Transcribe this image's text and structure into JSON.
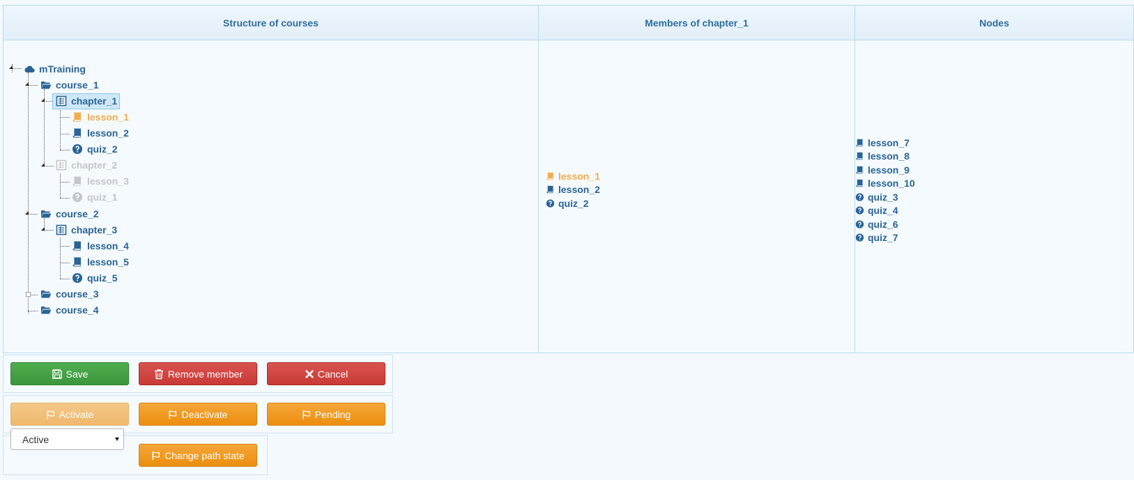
{
  "columns": {
    "structure": "Structure of courses",
    "members": "Members of chapter_1",
    "nodes": "Nodes"
  },
  "tree": {
    "root": "mTraining",
    "course_1": "course_1",
    "chapter_1": "chapter_1",
    "c1_lesson_1": "lesson_1",
    "c1_lesson_2": "lesson_2",
    "c1_quiz_2": "quiz_2",
    "chapter_2": "chapter_2",
    "c2_lesson_3": "lesson_3",
    "c2_quiz_1": "quiz_1",
    "course_2": "course_2",
    "chapter_3": "chapter_3",
    "c3_lesson_4": "lesson_4",
    "c3_lesson_5": "lesson_5",
    "c3_quiz_5": "quiz_5",
    "course_3": "course_3",
    "course_4": "course_4"
  },
  "members": [
    "lesson_1",
    "lesson_2",
    "quiz_2"
  ],
  "nodes": [
    "lesson_7",
    "lesson_8",
    "lesson_9",
    "lesson_10",
    "quiz_3",
    "quiz_4",
    "quiz_6",
    "quiz_7"
  ],
  "buttons": {
    "save": "Save",
    "remove_member": "Remove member",
    "cancel": "Cancel",
    "activate": "Activate",
    "deactivate": "Deactivate",
    "pending": "Pending",
    "change_path_state": "Change path state"
  },
  "state_select": {
    "value": "Active"
  },
  "colors": {
    "link": "#2a6496",
    "active_item": "#f0ad4e",
    "inactive_item": "#c2c6ca",
    "save": "#46a546",
    "danger": "#d9534f",
    "warning": "#f0a030"
  }
}
